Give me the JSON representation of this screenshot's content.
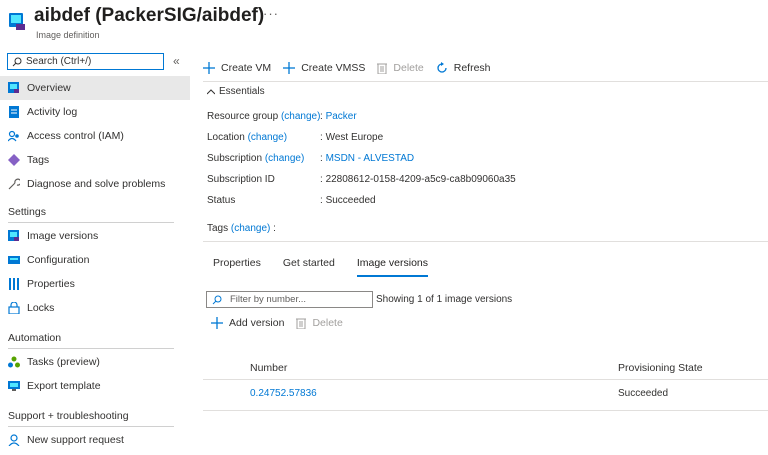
{
  "header": {
    "title": "aibdef (PackerSIG/aibdef)",
    "subtitle": "Image definition",
    "more_label": "···"
  },
  "sidebar": {
    "search_placeholder": "Search (Ctrl+/)",
    "collapse_label": "«",
    "items_top": [
      {
        "label": "Overview",
        "icon": "overview-icon"
      },
      {
        "label": "Activity log",
        "icon": "activity-log-icon"
      },
      {
        "label": "Access control (IAM)",
        "icon": "iam-icon"
      },
      {
        "label": "Tags",
        "icon": "tag-icon"
      },
      {
        "label": "Diagnose and solve problems",
        "icon": "wrench-icon"
      }
    ],
    "settings_header": "Settings",
    "settings_items": [
      {
        "label": "Image versions",
        "icon": "image-versions-icon"
      },
      {
        "label": "Configuration",
        "icon": "configuration-icon"
      },
      {
        "label": "Properties",
        "icon": "properties-icon"
      },
      {
        "label": "Locks",
        "icon": "lock-icon"
      }
    ],
    "automation_header": "Automation",
    "automation_items": [
      {
        "label": "Tasks (preview)",
        "icon": "tasks-icon"
      },
      {
        "label": "Export template",
        "icon": "export-template-icon"
      }
    ],
    "support_header": "Support + troubleshooting",
    "support_items": [
      {
        "label": "New support request",
        "icon": "support-icon"
      }
    ]
  },
  "toolbar": {
    "create_vm": "Create VM",
    "create_vmss": "Create VMSS",
    "delete": "Delete",
    "refresh": "Refresh"
  },
  "essentials": {
    "toggle_label": "Essentials",
    "resource_group_label": "Resource group",
    "resource_group_change": "(change)",
    "resource_group_value": "Packer",
    "location_label": "Location",
    "location_change": "(change)",
    "location_value": "West Europe",
    "subscription_label": "Subscription",
    "subscription_change": "(change)",
    "subscription_value": "MSDN - ALVESTAD",
    "subscription_id_label": "Subscription ID",
    "subscription_id_value": "22808612-0158-4209-a5c9-ca8b09060a35",
    "status_label": "Status",
    "status_value": "Succeeded",
    "tags_label": "Tags",
    "tags_change": "(change)",
    "colon": ":"
  },
  "tabs": [
    {
      "label": "Properties"
    },
    {
      "label": "Get started"
    },
    {
      "label": "Image versions"
    }
  ],
  "versions": {
    "filter_placeholder": "Filter by number...",
    "showing_text": "Showing 1 of 1 image versions",
    "add_version": "Add version",
    "delete": "Delete",
    "columns": [
      "Number",
      "Provisioning State"
    ],
    "rows": [
      {
        "number": "0.24752.57836",
        "state": "Succeeded"
      }
    ]
  },
  "colors": {
    "accent": "#0078d4",
    "selected_bg": "#e8e8e8"
  }
}
